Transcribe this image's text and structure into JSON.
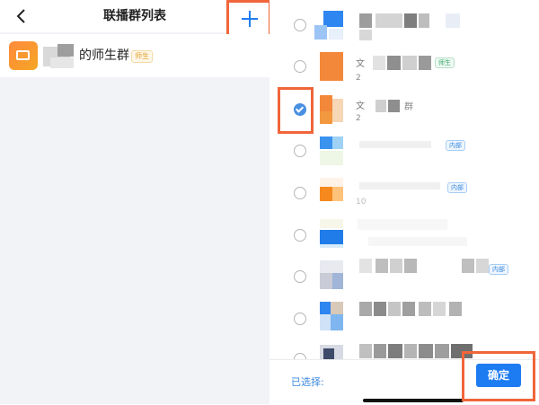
{
  "left_panel": {
    "title": "联播群列表",
    "group": {
      "name": "的师生群",
      "tag": "师生"
    }
  },
  "right_panel": {
    "rows": [
      {
        "checked": false,
        "sub": "",
        "tag": ""
      },
      {
        "checked": false,
        "sub": "2",
        "tag": "师生"
      },
      {
        "checked": true,
        "sub": "2",
        "tag": ""
      },
      {
        "checked": false,
        "sub": "",
        "tag": "内部"
      },
      {
        "checked": false,
        "sub": "10",
        "tag": "内部"
      },
      {
        "checked": false,
        "sub": "",
        "tag": ""
      },
      {
        "checked": false,
        "sub": "",
        "tag": "内部"
      },
      {
        "checked": false,
        "sub": "",
        "tag": ""
      },
      {
        "checked": false,
        "sub": "",
        "tag": ""
      }
    ],
    "footer": {
      "selected_label": "已选择:",
      "confirm_label": "确定"
    }
  },
  "colors": {
    "accent": "#1e7cf2",
    "highlight_box": "#f0653a",
    "left_bg": "#f2f3f7"
  },
  "icons": [
    "back-arrow-icon",
    "plus-icon",
    "book-icon",
    "check-icon"
  ]
}
